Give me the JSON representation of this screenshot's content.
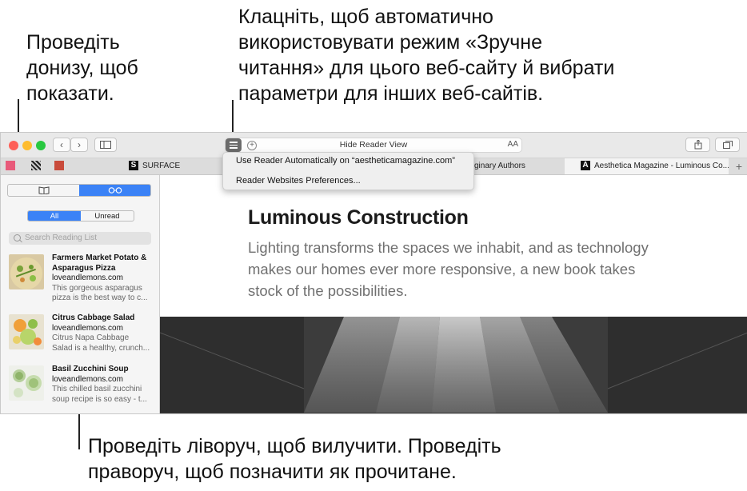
{
  "callouts": {
    "top_center": [
      "Клацніть, щоб автоматично",
      "використовувати режим «Зручне",
      "читання» для цього веб-сайту й вибрати",
      "параметри для інших веб-сайтів."
    ],
    "top_left": [
      "Проведіть",
      "донизу, щоб",
      "показати."
    ],
    "bottom": [
      "Проведіть ліворуч, щоб вилучити. Проведіть",
      "праворуч, щоб позначити як прочитане."
    ]
  },
  "toolbar": {
    "back_icon": "chevron-left-icon",
    "forward_icon": "chevron-right-icon",
    "sidebar_icon": "sidebar-icon",
    "url_title": "Hide Reader View",
    "font_size_label": "AA",
    "share_icon": "share-icon",
    "tabs_icon": "tabs-overview-icon"
  },
  "tabs": [
    {
      "label": "SURFACE",
      "favicon": "S"
    },
    {
      "label": "ginary Authors",
      "favicon": ""
    },
    {
      "label": "Aesthetica Magazine - Luminous Co...",
      "favicon": "A"
    }
  ],
  "reader_menu": {
    "items": [
      "Use Reader Automatically on “aestheticamagazine.com”",
      "Reader Websites Preferences..."
    ]
  },
  "sidebar": {
    "segment_bookmarks_icon": "book-icon",
    "segment_reading_icon": "glasses-icon",
    "filter_all": "All",
    "filter_unread": "Unread",
    "search_placeholder": "Search Reading List",
    "items": [
      {
        "title_line1": "Farmers Market Potato &",
        "title_line2": "Asparagus Pizza",
        "domain": "loveandlemons.com",
        "desc_line1": "This gorgeous asparagus",
        "desc_line2": "pizza is the best way to c..."
      },
      {
        "title_line1": "Citrus Cabbage Salad",
        "title_line2": "",
        "domain": "loveandlemons.com",
        "desc_line1": "Citrus Napa Cabbage",
        "desc_line2": "Salad is a healthy, crunch..."
      },
      {
        "title_line1": "Basil Zucchini Soup",
        "title_line2": "",
        "domain": "loveandlemons.com",
        "desc_line1": "This chilled basil zucchini",
        "desc_line2": "soup recipe is so easy - t..."
      }
    ]
  },
  "article": {
    "title": "Luminous Construction",
    "dek": "Lighting transforms the spaces we inhabit, and as technology makes our homes ever more responsive, a new book takes stock of the possibilities."
  },
  "colors": {
    "accent": "#3b82f6",
    "traffic_red": "#fe5f57",
    "traffic_yellow": "#febc2e",
    "traffic_green": "#28c840"
  }
}
